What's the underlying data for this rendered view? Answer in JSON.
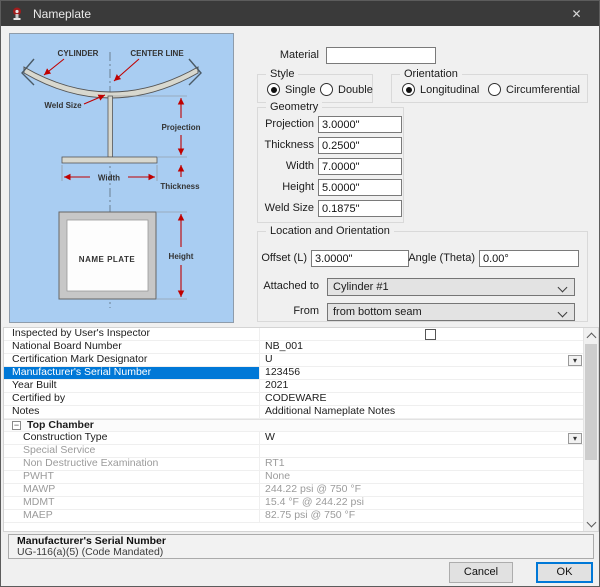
{
  "window": {
    "title": "Nameplate",
    "close_glyph": "✕"
  },
  "colors": {
    "selection": "#0078d7",
    "titlebar": "#3a3a3a",
    "diagram_bg": "#a9cdf2",
    "dimension_red": "#c00000"
  },
  "diagram": {
    "cylinder": "CYLINDER",
    "center_line": "CENTER LINE",
    "weld_size": "Weld Size",
    "projection": "Projection",
    "width": "Width",
    "thickness": "Thickness",
    "name_plate": "NAME PLATE",
    "height": "Height"
  },
  "form": {
    "material": {
      "label": "Material",
      "value": ""
    },
    "style": {
      "label": "Style",
      "options": [
        {
          "label": "Single",
          "selected": true
        },
        {
          "label": "Double",
          "selected": false
        }
      ]
    },
    "orientation": {
      "label": "Orientation",
      "options": [
        {
          "label": "Longitudinal",
          "selected": true
        },
        {
          "label": "Circumferential",
          "selected": false
        }
      ]
    },
    "geometry": {
      "label": "Geometry",
      "fields": [
        {
          "label": "Projection",
          "value": "3.0000\""
        },
        {
          "label": "Thickness",
          "value": "0.2500\""
        },
        {
          "label": "Width",
          "value": "7.0000\""
        },
        {
          "label": "Height",
          "value": "5.0000\""
        },
        {
          "label": "Weld Size",
          "value": "0.1875\""
        }
      ]
    },
    "location": {
      "label": "Location and Orientation",
      "offset": {
        "label": "Offset (L)",
        "value": "3.0000\""
      },
      "angle": {
        "label": "Angle (Theta)",
        "value": "0.00°"
      },
      "attached": {
        "label": "Attached to",
        "value": "Cylinder #1"
      },
      "from": {
        "label": "From",
        "value": "from bottom seam"
      }
    }
  },
  "grid": {
    "rows": [
      {
        "label": "Inspected by User's Inspector",
        "value": "",
        "control": "checkbox",
        "checked": false
      },
      {
        "label": "National Board Number",
        "value": "NB_001"
      },
      {
        "label": "Certification Mark Designator",
        "value": "U",
        "control": "dropdown"
      },
      {
        "label": "Manufacturer's Serial Number",
        "value": "123456",
        "selected": true
      },
      {
        "label": "Year Built",
        "value": "2021"
      },
      {
        "label": "Certified by",
        "value": "CODEWARE"
      },
      {
        "label": "Notes",
        "value": "Additional Nameplate Notes"
      },
      {
        "label": "Top Chamber",
        "kind": "group",
        "collapse_glyph": "−"
      },
      {
        "label": "Construction Type",
        "value": "W",
        "control": "dropdown",
        "indent": true
      },
      {
        "label": "Special Service",
        "value": "",
        "disabled": true,
        "indent": true
      },
      {
        "label": "Non Destructive Examination",
        "value": "RT1",
        "disabled": true,
        "indent": true
      },
      {
        "label": "PWHT",
        "value": "None",
        "disabled": true,
        "indent": true
      },
      {
        "label": "MAWP",
        "value": "244.22 psi @ 750 °F",
        "disabled": true,
        "indent": true
      },
      {
        "label": "MDMT",
        "value": "15.4 °F @ 244.22 psi",
        "disabled": true,
        "indent": true
      },
      {
        "label": "MAEP",
        "value": "82.75 psi @ 750 °F",
        "disabled": true,
        "indent": true
      }
    ]
  },
  "info": {
    "title": "Manufacturer's Serial Number",
    "description": "UG-116(a)(5) (Code Mandated)"
  },
  "buttons": {
    "cancel": "Cancel",
    "ok": "OK"
  }
}
